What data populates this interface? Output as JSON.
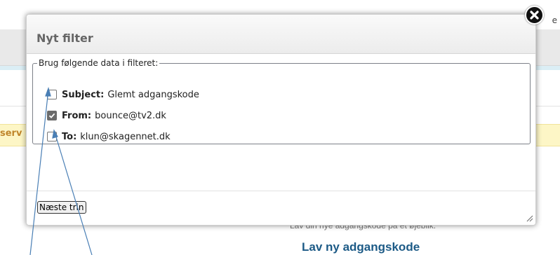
{
  "background": {
    "warning_text": "serv",
    "right_text": "e",
    "hint_text": "Lav din nye adgangskode på et øjeblik.",
    "heading": "Lav ny adgangskode"
  },
  "dialog": {
    "title": "Nyt filter",
    "legend": "Brug følgende data i filteret:",
    "options": [
      {
        "label": "Subject:",
        "value": "Glemt adgangskode",
        "checked": false
      },
      {
        "label": "From:",
        "value": "bounce@tv2.dk",
        "checked": true
      },
      {
        "label": "To:",
        "value": "klun@skagennet.dk",
        "checked": false
      }
    ],
    "next_button": "Næste trin"
  },
  "icons": {
    "close": "close-icon",
    "checkmark": "checkmark-icon",
    "resize": "resize-grip-icon"
  },
  "colors": {
    "annotation_arrow": "#4a7fb5",
    "heading_blue": "#1c5a86",
    "warning_bg": "#fdf6c6"
  }
}
